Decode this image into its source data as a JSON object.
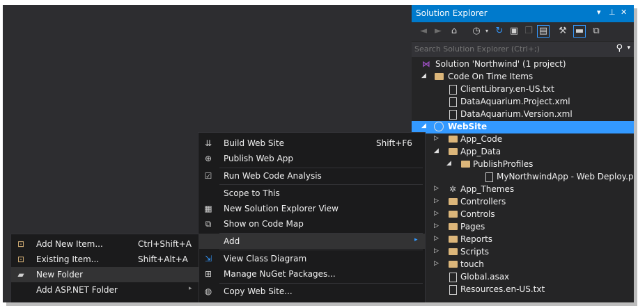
{
  "solution_explorer": {
    "title": "Solution Explorer",
    "title_controls": [
      "▾",
      "⊥",
      "✕"
    ],
    "search_placeholder": "Search Solution Explorer (Ctrl+;)",
    "tree": [
      {
        "label": "Solution 'Northwind' (1 project)",
        "icon": "vs-solution-icon",
        "depth": 0,
        "arrow": ""
      },
      {
        "label": "Code On Time Items",
        "icon": "folder-icon",
        "depth": 1,
        "arrow": "◢"
      },
      {
        "label": "ClientLibrary.en-US.txt",
        "icon": "file-icon",
        "depth": 2,
        "arrow": ""
      },
      {
        "label": "DataAquarium.Project.xml",
        "icon": "xml-file-icon",
        "depth": 2,
        "arrow": ""
      },
      {
        "label": "DataAquarium.Version.xml",
        "icon": "xml-file-icon",
        "depth": 2,
        "arrow": ""
      },
      {
        "label": "WebSite",
        "icon": "globe-icon",
        "depth": 1,
        "arrow": "◢",
        "selected": true
      },
      {
        "label": "App_Code",
        "icon": "folder-icon",
        "depth": 2,
        "arrow": "▷"
      },
      {
        "label": "App_Data",
        "icon": "folder-icon",
        "depth": 2,
        "arrow": "◢"
      },
      {
        "label": "PublishProfiles",
        "icon": "folder-icon",
        "depth": 3,
        "arrow": "◢"
      },
      {
        "label": "MyNorthwindApp - Web Deploy.pubxml",
        "icon": "xml-file-icon",
        "depth": 4,
        "arrow": ""
      },
      {
        "label": "App_Themes",
        "icon": "themes-icon",
        "depth": 2,
        "arrow": "▷"
      },
      {
        "label": "Controllers",
        "icon": "folder-icon",
        "depth": 2,
        "arrow": "▷"
      },
      {
        "label": "Controls",
        "icon": "folder-icon",
        "depth": 2,
        "arrow": "▷"
      },
      {
        "label": "Pages",
        "icon": "folder-icon",
        "depth": 2,
        "arrow": "▷"
      },
      {
        "label": "Reports",
        "icon": "folder-icon",
        "depth": 2,
        "arrow": "▷"
      },
      {
        "label": "Scripts",
        "icon": "folder-icon",
        "depth": 2,
        "arrow": "▷"
      },
      {
        "label": "touch",
        "icon": "folder-icon",
        "depth": 2,
        "arrow": "▷"
      },
      {
        "label": "Global.asax",
        "icon": "file-icon",
        "depth": 2,
        "arrow": ""
      },
      {
        "label": "Resources.en-US.txt",
        "icon": "file-icon",
        "depth": 2,
        "arrow": ""
      }
    ]
  },
  "context_menu": {
    "items": [
      {
        "label": "Build Web Site",
        "shortcut": "Shift+F6",
        "icon": "build-icon"
      },
      {
        "label": "Publish Web App",
        "shortcut": "",
        "icon": "publish-icon"
      },
      {
        "label": "Run Web Code Analysis",
        "shortcut": "",
        "icon": "code-analysis-icon"
      },
      {
        "label": "Scope to This",
        "shortcut": "",
        "icon": ""
      },
      {
        "label": "New Solution Explorer View",
        "shortcut": "",
        "icon": "new-view-icon"
      },
      {
        "label": "Show on Code Map",
        "shortcut": "",
        "icon": "code-map-icon"
      },
      {
        "label": "Add",
        "shortcut": "",
        "icon": "",
        "submenu": true,
        "highlighted": true
      },
      {
        "label": "View Class Diagram",
        "shortcut": "",
        "icon": "class-diagram-icon"
      },
      {
        "label": "Manage NuGet Packages...",
        "shortcut": "",
        "icon": "nuget-icon"
      },
      {
        "label": "Copy Web Site...",
        "shortcut": "",
        "icon": "copy-web-icon"
      }
    ]
  },
  "add_submenu": {
    "items": [
      {
        "label": "Add New Item...",
        "shortcut": "Ctrl+Shift+A",
        "icon": "new-item-icon"
      },
      {
        "label": "Existing Item...",
        "shortcut": "Shift+Alt+A",
        "icon": "existing-item-icon"
      },
      {
        "label": "New Folder",
        "shortcut": "",
        "icon": "new-folder-icon",
        "highlighted": true
      },
      {
        "label": "Add ASP.NET Folder",
        "shortcut": "",
        "icon": "",
        "submenu": true
      }
    ]
  },
  "colors": {
    "background": "#2d2d30",
    "accent": "#007acc",
    "selection": "#3399ff",
    "menu_bg": "#1b1b1c",
    "folder": "#dcb67a"
  }
}
